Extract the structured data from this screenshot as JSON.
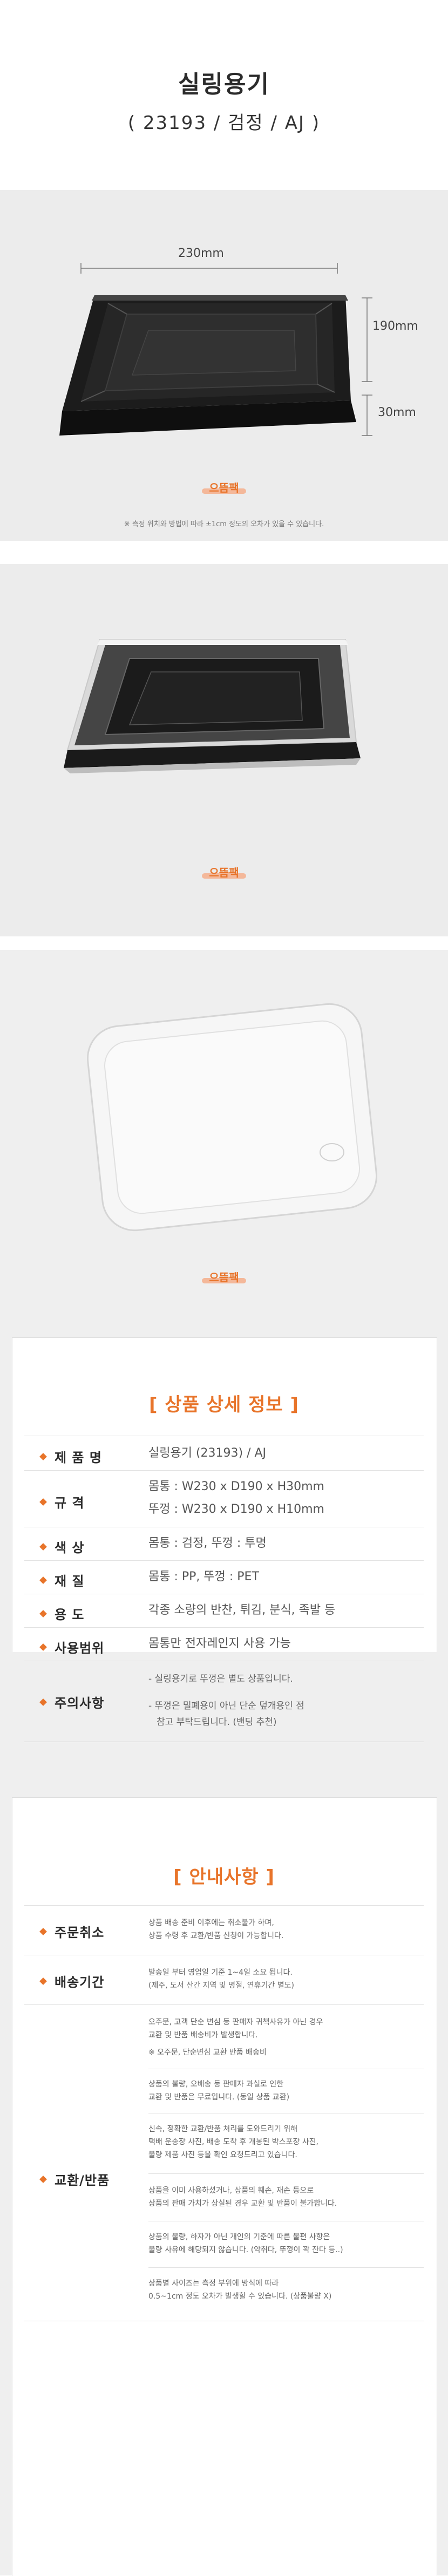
{
  "header": {
    "title": "실링용기",
    "subtitle": "( 23193 / 검정 / AJ )"
  },
  "photo1": {
    "width_label": "230mm",
    "depth_label": "190mm",
    "height_label": "30mm",
    "logo_text": "으뜸팩",
    "note": "※ 측정 위치와 방법에 따라 ±1cm 정도의 오차가 있을 수 있습니다."
  },
  "photo2": {
    "logo_text": "으뜸팩"
  },
  "photo3": {
    "logo_text": "으뜸팩"
  },
  "details": {
    "title": "[ 상품 상세 정보 ]",
    "rows": [
      {
        "label": "제 품 명",
        "value": "실링용기 (23193) / AJ"
      },
      {
        "label": "규      격",
        "value1": "몸통 : W230 x D190 x H30mm",
        "value2": "뚜껑 : W230 x D190 x H10mm"
      },
      {
        "label": "색      상",
        "value": "몸통 : 검정,  뚜껑 : 투명"
      },
      {
        "label": "재      질",
        "value": "몸통 : PP,  뚜껑 : PET"
      },
      {
        "label": "용      도",
        "value": "각종 소량의 반찬, 튀김, 분식, 족발 등"
      },
      {
        "label": "사용범위",
        "value": "몸통만 전자레인지 사용 가능"
      },
      {
        "label": "주의사항",
        "value1": "- 실링용기로 뚜껑은 별도 상품입니다.",
        "value2": "- 뚜껑은 밀폐용이 아닌 단순 덮개용인 점",
        "value3": "참고 부탁드립니다. (밴딩 추천)"
      }
    ]
  },
  "notice": {
    "title": "[ 안내사항 ]",
    "rows": [
      {
        "label": "주문취소",
        "lines": [
          "상품 배송 준비 이후에는 취소불가 하며,",
          "상품 수령 후 교환/반품 신청이 가능합니다."
        ]
      },
      {
        "label": "배송기간",
        "lines": [
          "발송일 부터 영업일 기준 1~4일 소요 됩니다.",
          "(제주, 도서 산간 지역 및 명절, 연휴기간 별도)"
        ]
      },
      {
        "label": "교환/반품",
        "groups": [
          [
            "오주문, 고객 단순 변심 등 판매자 귀책사유가 아닌 경우",
            "교환 및 반품 배송비가 발생합니다.",
            "※ 오주문, 단순변심 교환 반품 배송비"
          ],
          [
            "상품의 불량, 오배송 등 판매자 과실로 인한",
            "교환 및 반품은 무료입니다. (동일 상품 교환)"
          ],
          [
            "신속, 정확한 교환/반품 처리를 도와드리기 위해",
            "택배 운송장 사진, 배송 도착 후 개봉된 박스포장 사진,",
            "불량 제품 사진 등을 확인 요청드리고 있습니다."
          ],
          [
            "상품을 이미 사용하셨거나, 상품의 훼손, 재손 등으로",
            "상품의 판매 가치가 상실된 경우 교환 및 반품이 불가합니다."
          ],
          [
            "상품의 불량, 하자가 아닌 개인의 기준에 따른 불편 사항은",
            "불량 사유에 해당되지 않습니다. (악취다, 뚜껑이 꽉 잔다 등..)"
          ],
          [
            "상품별 사이즈는 측정 부위에 방식에 따라",
            "0.5~1cm 정도 오차가 발생할 수 있습니다. (상품불량 X)"
          ]
        ]
      }
    ]
  }
}
